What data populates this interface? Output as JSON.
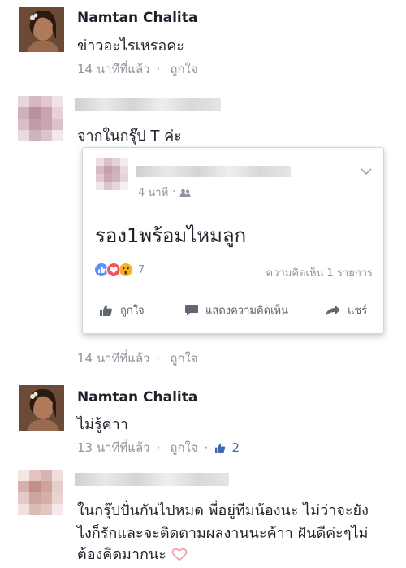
{
  "comments": [
    {
      "author": "Namtan Chalita",
      "text": "ข่าวอะไรเหรอคะ",
      "time": "14 นาทีที่แล้ว",
      "like": "ถูกใจ"
    },
    {
      "text": "จากในกรุ๊ป T ค่ะ",
      "time": "14 นาทีที่แล้ว",
      "like": "ถูกใจ"
    },
    {
      "author": "Namtan Chalita",
      "text": "ไม่รู้ค่าา",
      "time": "13 นาทีที่แล้ว",
      "like": "ถูกใจ",
      "like_count": "2"
    },
    {
      "text_line1": "ในกรุ๊ปปั่นกันไปหมด พี่อยู่ทีมน้องนะ ไม่ว่าจะยัง",
      "text_line2": "ไงก็รักและจะติดตามผลงานนะค้าา ฝันดีค่ะๆไม่",
      "text_line3": "ต้องคิดมากนะ"
    }
  ],
  "shared_post": {
    "time": "4 นาที",
    "text": "รอง1พร้อมไหมลูก",
    "reaction_count": "7",
    "comment_count": "ความคิดเห็น 1 รายการ",
    "actions": {
      "like": "ถูกใจ",
      "comment": "แสดงความคิดเห็น",
      "share": "แชร์"
    }
  },
  "meta_separator": "·",
  "colors": {
    "accent_blue": "#4267b2",
    "like_blue": "#5890ff",
    "love_red": "#f25268",
    "wow_yellow": "#f7b125",
    "meta_gray": "#90949c",
    "heart_pink": "#f0a0ae"
  }
}
